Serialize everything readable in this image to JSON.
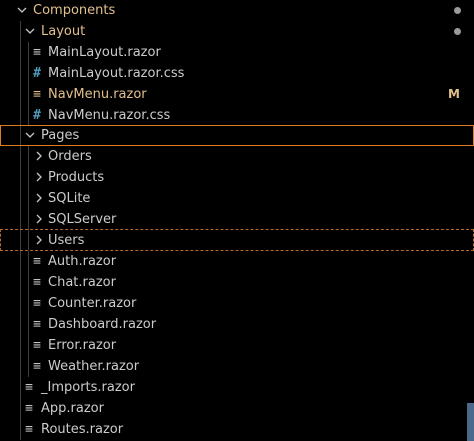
{
  "explorer": {
    "components": {
      "label": "Components",
      "expanded": true,
      "has_changes": true
    },
    "layout": {
      "label": "Layout",
      "expanded": true,
      "has_changes": true
    },
    "files_layout": [
      {
        "label": "MainLayout.razor",
        "icon": "≡"
      },
      {
        "label": "MainLayout.razor.css",
        "icon": "#"
      },
      {
        "label": "NavMenu.razor",
        "icon": "≡",
        "status": "M"
      },
      {
        "label": "NavMenu.razor.css",
        "icon": "#"
      }
    ],
    "pages": {
      "label": "Pages",
      "expanded": true
    },
    "page_folders": [
      {
        "label": "Orders"
      },
      {
        "label": "Products"
      },
      {
        "label": "SQLite"
      },
      {
        "label": "SQLServer"
      },
      {
        "label": "Users"
      }
    ],
    "page_files": [
      {
        "label": "Auth.razor",
        "icon": "≡"
      },
      {
        "label": "Chat.razor",
        "icon": "≡"
      },
      {
        "label": "Counter.razor",
        "icon": "≡"
      },
      {
        "label": "Dashboard.razor",
        "icon": "≡"
      },
      {
        "label": "Error.razor",
        "icon": "≡"
      },
      {
        "label": "Weather.razor",
        "icon": "≡"
      }
    ],
    "root_files": [
      {
        "label": "_Imports.razor",
        "icon": "≡"
      },
      {
        "label": "App.razor",
        "icon": "≡"
      },
      {
        "label": "Routes.razor",
        "icon": "≡"
      }
    ]
  },
  "colors": {
    "background": "#000000",
    "text": "#cccccc",
    "modified": "#e2c08d",
    "selection_border": "#e07b24",
    "css_icon": "#519aba"
  }
}
